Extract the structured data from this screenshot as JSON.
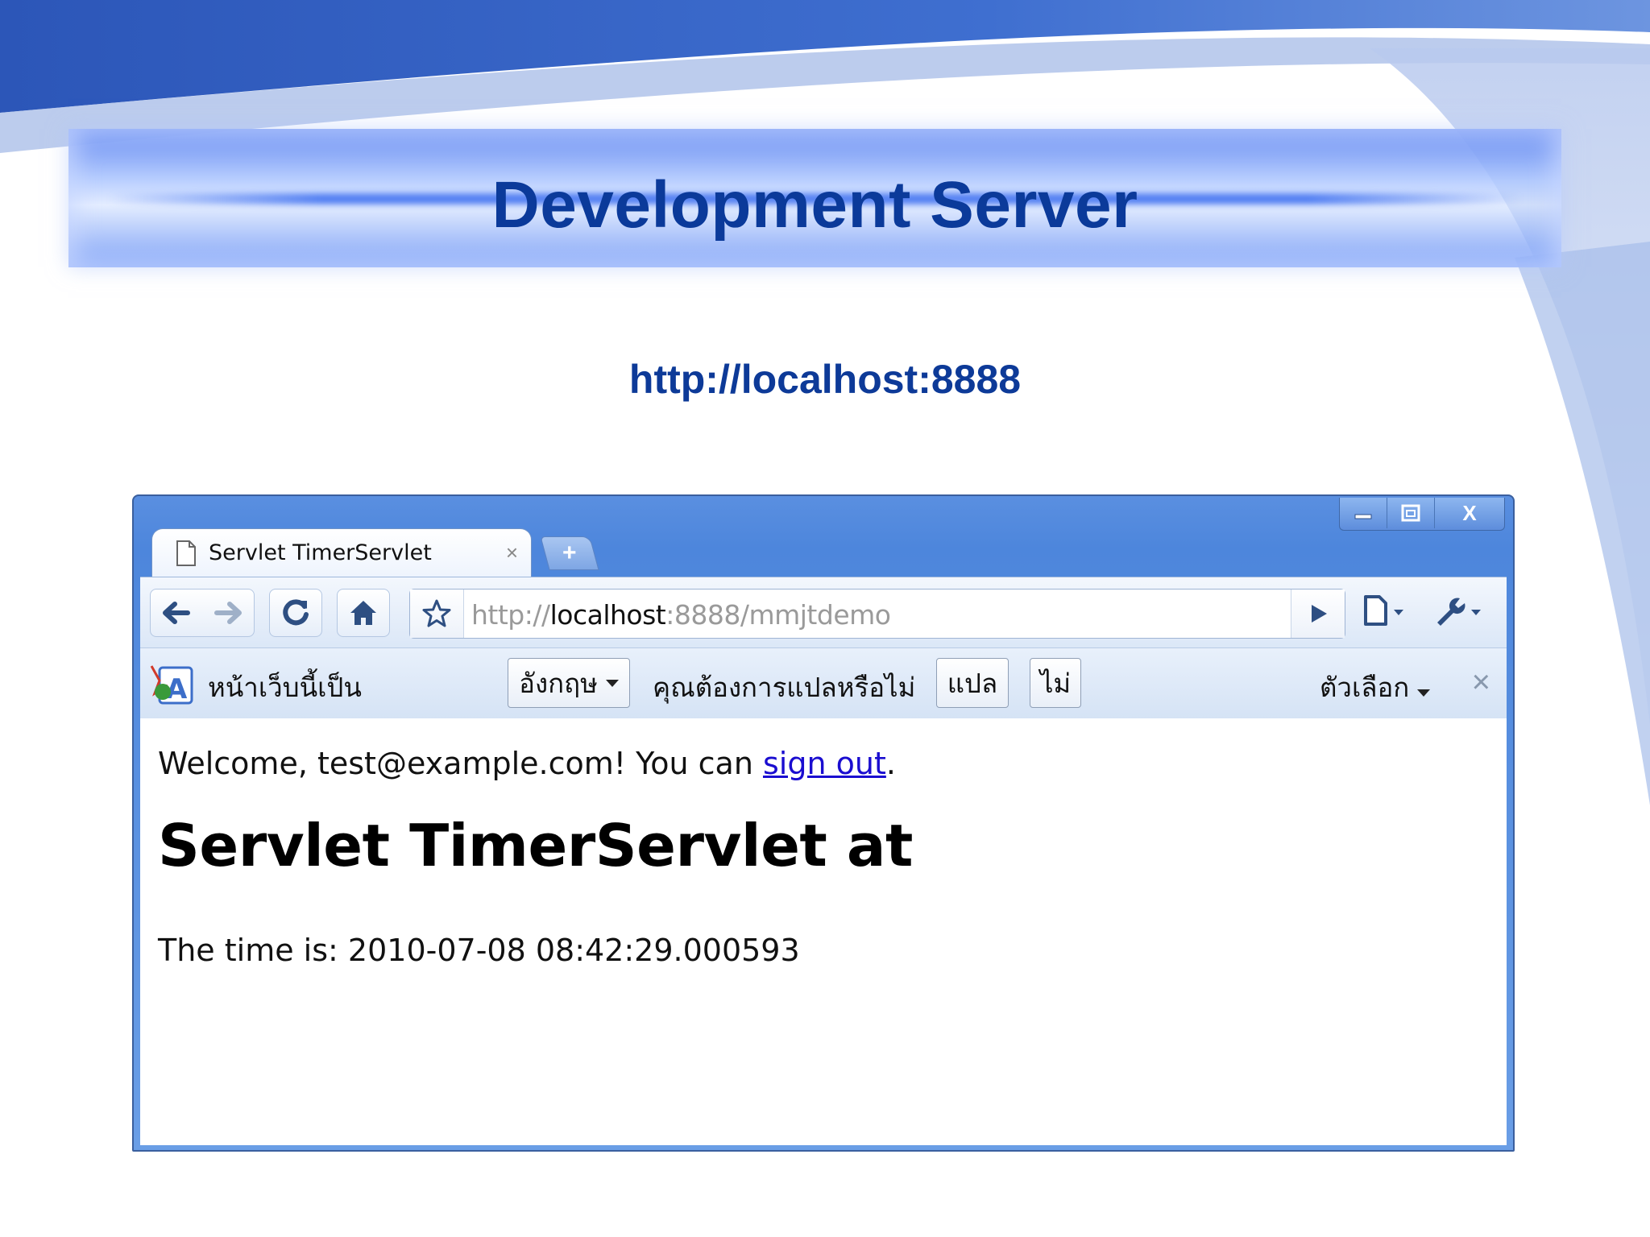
{
  "slide": {
    "title": "Development Server",
    "url_caption": "http://localhost:8888"
  },
  "window": {
    "controls": {
      "minimize_icon": "minimize-icon",
      "maximize_icon": "maximize-icon",
      "close_label": "X"
    },
    "tab": {
      "title": "Servlet TimerServlet",
      "close": "×"
    },
    "new_tab_label": "+",
    "toolbar": {
      "url_prefix": "http://",
      "url_host": "localhost",
      "url_rest": ":8888/mmjtdemo"
    },
    "infobar": {
      "text_page_is": "หน้าเว็บนี้เป็น",
      "language_select": "อังกฤษ",
      "question": "คุณต้องการแปลหรือไม่",
      "translate_button": "แปล",
      "no_button": "ไม่",
      "options_label": "ตัวเลือก",
      "close": "×"
    },
    "content": {
      "welcome_prefix": "Welcome, test@example.com! You can ",
      "sign_out_link": "sign out",
      "welcome_suffix": ".",
      "heading": "Servlet TimerServlet at",
      "time_text": "The time is: 2010-07-08 08:42:29.000593"
    }
  },
  "colors": {
    "title_blue": "#0b3a9a",
    "window_frame": "#5a8fe0",
    "link": "#1a0dd0"
  }
}
